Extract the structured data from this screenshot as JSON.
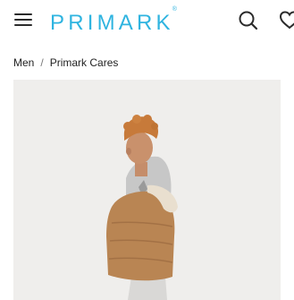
{
  "header": {
    "logo_text": "PRIMARK",
    "logo_mark": "®",
    "menu_icon": "hamburger-menu-icon",
    "search_icon": "search-icon",
    "wishlist_icon": "heart-icon"
  },
  "breadcrumb": {
    "items": [
      "Men",
      "Primark Cares"
    ],
    "separator": "/"
  },
  "product": {
    "image_description_icon": "product-photo"
  },
  "colors": {
    "brand": "#2fb4e0",
    "text": "#222222",
    "image_bg": "#efeeec"
  }
}
